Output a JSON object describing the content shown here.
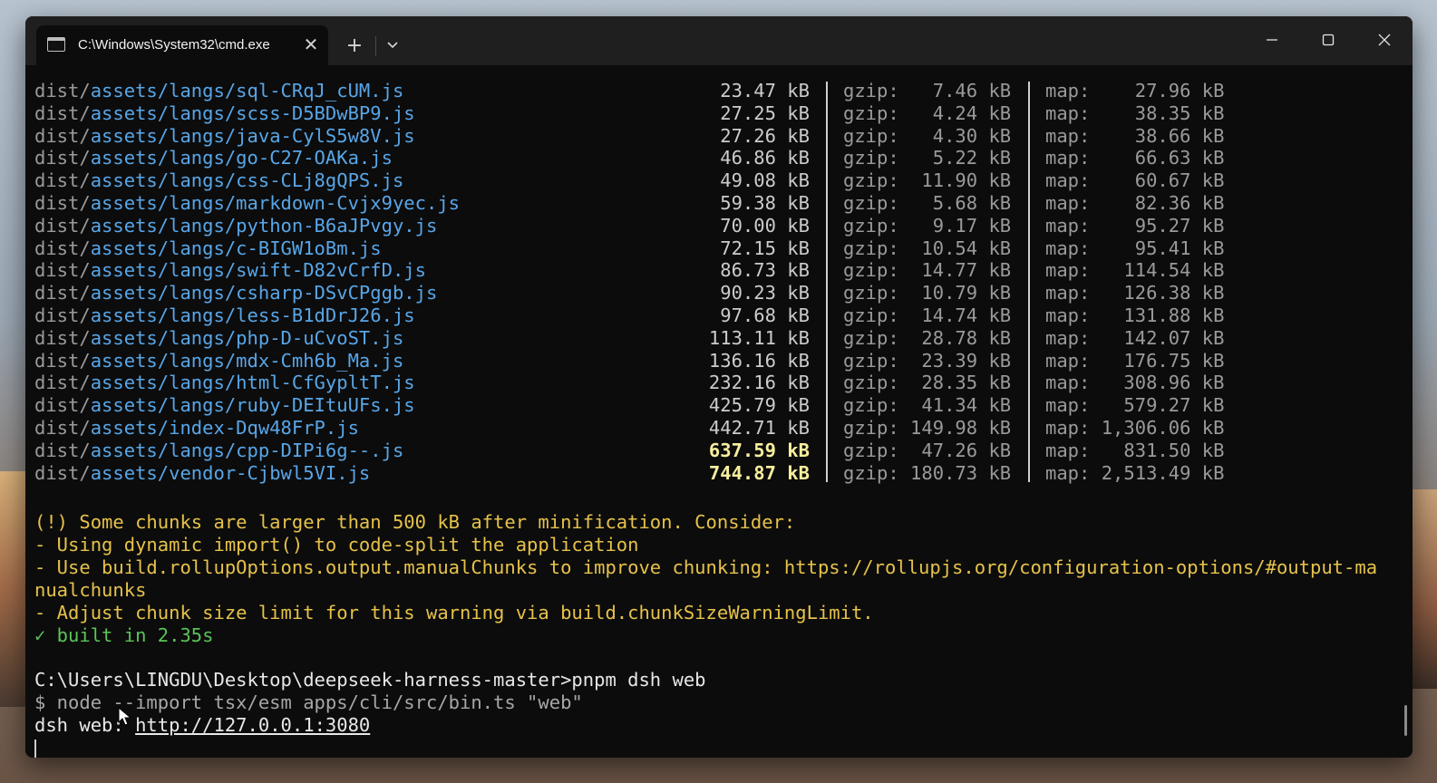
{
  "window": {
    "tab_title": "C:\\Windows\\System32\\cmd.exe",
    "tab_close_icon": "close-icon",
    "new_tab_label": "+",
    "dropdown_icon": "chevron-down-icon"
  },
  "build_output": [
    {
      "prefix": "dist/",
      "file": "assets/langs/sql-CRqJ_cUM.js",
      "size": "23.47 kB",
      "gzip": "gzip:   7.46 kB",
      "map": "map:    27.96 kB"
    },
    {
      "prefix": "dist/",
      "file": "assets/langs/scss-D5BDwBP9.js",
      "size": "27.25 kB",
      "gzip": "gzip:   4.24 kB",
      "map": "map:    38.35 kB"
    },
    {
      "prefix": "dist/",
      "file": "assets/langs/java-CylS5w8V.js",
      "size": "27.26 kB",
      "gzip": "gzip:   4.30 kB",
      "map": "map:    38.66 kB"
    },
    {
      "prefix": "dist/",
      "file": "assets/langs/go-C27-OAKa.js",
      "size": "46.86 kB",
      "gzip": "gzip:   5.22 kB",
      "map": "map:    66.63 kB"
    },
    {
      "prefix": "dist/",
      "file": "assets/langs/css-CLj8gQPS.js",
      "size": "49.08 kB",
      "gzip": "gzip:  11.90 kB",
      "map": "map:    60.67 kB"
    },
    {
      "prefix": "dist/",
      "file": "assets/langs/markdown-Cvjx9yec.js",
      "size": "59.38 kB",
      "gzip": "gzip:   5.68 kB",
      "map": "map:    82.36 kB"
    },
    {
      "prefix": "dist/",
      "file": "assets/langs/python-B6aJPvgy.js",
      "size": "70.00 kB",
      "gzip": "gzip:   9.17 kB",
      "map": "map:    95.27 kB"
    },
    {
      "prefix": "dist/",
      "file": "assets/langs/c-BIGW1oBm.js",
      "size": "72.15 kB",
      "gzip": "gzip:  10.54 kB",
      "map": "map:    95.41 kB"
    },
    {
      "prefix": "dist/",
      "file": "assets/langs/swift-D82vCrfD.js",
      "size": "86.73 kB",
      "gzip": "gzip:  14.77 kB",
      "map": "map:   114.54 kB"
    },
    {
      "prefix": "dist/",
      "file": "assets/langs/csharp-DSvCPggb.js",
      "size": "90.23 kB",
      "gzip": "gzip:  10.79 kB",
      "map": "map:   126.38 kB"
    },
    {
      "prefix": "dist/",
      "file": "assets/langs/less-B1dDrJ26.js",
      "size": "97.68 kB",
      "gzip": "gzip:  14.74 kB",
      "map": "map:   131.88 kB"
    },
    {
      "prefix": "dist/",
      "file": "assets/langs/php-D-uCvoST.js",
      "size": "113.11 kB",
      "gzip": "gzip:  28.78 kB",
      "map": "map:   142.07 kB"
    },
    {
      "prefix": "dist/",
      "file": "assets/langs/mdx-Cmh6b_Ma.js",
      "size": "136.16 kB",
      "gzip": "gzip:  23.39 kB",
      "map": "map:   176.75 kB"
    },
    {
      "prefix": "dist/",
      "file": "assets/langs/html-CfGypltT.js",
      "size": "232.16 kB",
      "gzip": "gzip:  28.35 kB",
      "map": "map:   308.96 kB"
    },
    {
      "prefix": "dist/",
      "file": "assets/langs/ruby-DEItuUFs.js",
      "size": "425.79 kB",
      "gzip": "gzip:  41.34 kB",
      "map": "map:   579.27 kB"
    },
    {
      "prefix": "dist/",
      "file": "assets/index-Dqw48FrP.js",
      "size": "442.71 kB",
      "gzip": "gzip: 149.98 kB",
      "map": "map: 1,306.06 kB"
    },
    {
      "prefix": "dist/",
      "file": "assets/langs/cpp-DIPi6g--.js",
      "size": "637.59 kB",
      "gzip": "gzip:  47.26 kB",
      "map": "map:   831.50 kB",
      "warn": true
    },
    {
      "prefix": "dist/",
      "file": "assets/vendor-Cjbwl5VI.js",
      "size": "744.87 kB",
      "gzip": "gzip: 180.73 kB",
      "map": "map: 2,513.49 kB",
      "warn": true
    }
  ],
  "warning": {
    "line1": "(!) Some chunks are larger than 500 kB after minification. Consider:",
    "line2": "- Using dynamic import() to code-split the application",
    "line3": "- Use build.rollupOptions.output.manualChunks to improve chunking: https://rollupjs.org/configuration-options/#output-ma",
    "line4": "nualchunks",
    "line5": "- Adjust chunk size limit for this warning via build.chunkSizeWarningLimit."
  },
  "built": "✓ built in 2.35s",
  "prompt": "C:\\Users\\LINGDU\\Desktop\\deepseek-harness-master>pnpm dsh web",
  "node_cmd": "$ node --import tsx/esm apps/cli/src/bin.ts \"web\"",
  "server": {
    "label": "dsh web: ",
    "url": "http://127.0.0.1:3080"
  }
}
